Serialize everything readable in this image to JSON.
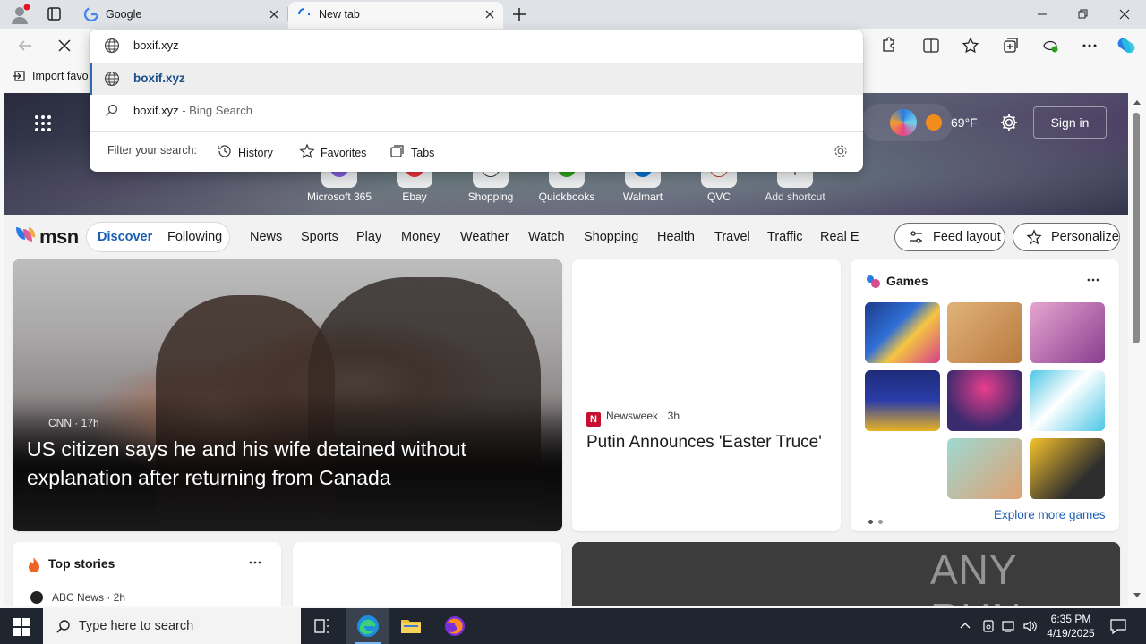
{
  "browser": {
    "tabs": [
      {
        "title": "Google"
      },
      {
        "title": "New tab"
      }
    ],
    "address_text": "boxif.xyz",
    "favorites_bar": {
      "import_label": "Import favo"
    }
  },
  "omnibox": {
    "typed": "boxif.xyz",
    "suggestion_url": "boxif.xyz",
    "search_query": "boxif.xyz",
    "search_suffix": " - Bing Search",
    "filter_label": "Filter your search:",
    "filters": [
      "History",
      "Favorites",
      "Tabs"
    ]
  },
  "hero": {
    "temperature": "69°F",
    "sign_in": "Sign in",
    "shortcuts": [
      {
        "label": "Microsoft 365",
        "color": "#7b5cd6"
      },
      {
        "label": "Ebay",
        "color": "#e53238"
      },
      {
        "label": "Shopping",
        "color": "#1a73e8"
      },
      {
        "label": "Quickbooks",
        "color": "#2ca01c"
      },
      {
        "label": "Walmart",
        "color": "#0071ce"
      },
      {
        "label": "QVC",
        "color": "#c0392b"
      },
      {
        "label": "Add shortcut",
        "color": "#555555"
      }
    ]
  },
  "msn": {
    "logo": "msn",
    "toggle": {
      "discover": "Discover",
      "following": "Following"
    },
    "nav": [
      "News",
      "Sports",
      "Play",
      "Money",
      "Weather",
      "Watch",
      "Shopping",
      "Health",
      "Travel",
      "Traffic",
      "Real E"
    ],
    "feed_layout": "Feed layout",
    "personalize": "Personalize"
  },
  "cards": {
    "main": {
      "source": "CNN · 17h",
      "title": "US citizen says he and his wife detained without explanation after returning from Canada"
    },
    "news": {
      "source": "Newsweek · 3h",
      "title": "Putin Announces 'Easter Truce'"
    },
    "games": {
      "title": "Games",
      "explore": "Explore more games",
      "tiles": [
        {
          "name": "jewel-game",
          "color": "#2a4fb8"
        },
        {
          "name": "wood-nuts-game",
          "color": "#c98b4a"
        },
        {
          "name": "makeup-game",
          "color": "#b064a8"
        },
        {
          "name": "blocks-game",
          "color": "#2f3f9e"
        },
        {
          "name": "bubble-shooter-game",
          "color": "#3a2a6e"
        },
        {
          "name": "mahjong-game",
          "color": "#3fb8d8"
        },
        {
          "name": "hospital-game",
          "color": "#7fc6c0"
        },
        {
          "name": "cube-game",
          "color": "#f2b51e"
        }
      ]
    },
    "top_stories": {
      "title": "Top stories",
      "source": "ABC News · 2h"
    },
    "watermark": "ANY RUN"
  },
  "taskbar": {
    "search_placeholder": "Type here to search",
    "time": "6:35 PM",
    "date": "4/19/2025"
  }
}
